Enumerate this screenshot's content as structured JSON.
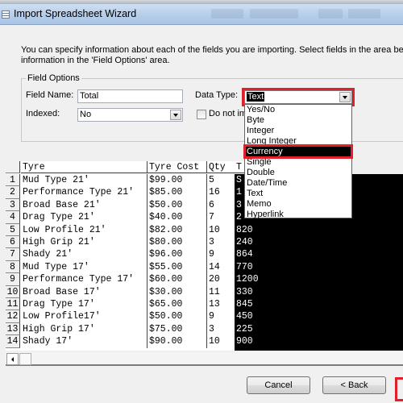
{
  "window": {
    "title": "Import Spreadsheet Wizard"
  },
  "intro": {
    "line1": "You can specify information about each of the fields you are importing. Select fields in the area below. You",
    "line2": "information in the 'Field Options' area."
  },
  "field_options": {
    "legend": "Field Options",
    "field_name_label": "Field Name:",
    "field_name_value": "Total",
    "indexed_label": "Indexed:",
    "indexed_value": "No",
    "data_type_label": "Data Type:",
    "data_type_value": "Text",
    "do_not_import_label": "Do not imp",
    "do_not_import_checked": false,
    "data_type_options": [
      "Yes/No",
      "Byte",
      "Integer",
      "Long Integer",
      "Currency",
      "Single",
      "Double",
      "Date/Time",
      "Text",
      "Memo",
      "Hyperlink"
    ],
    "highlighted_option": "Currency",
    "highlight_color": "#e0202a"
  },
  "grid": {
    "columns": [
      "Tyre",
      "Tyre Cost",
      "Qty",
      "T"
    ],
    "rows": [
      {
        "n": "1",
        "tyre": "Mud Type 21'",
        "cost": "$99.00",
        "qty": "5",
        "total": "S"
      },
      {
        "n": "2",
        "tyre": "Performance Type 21'",
        "cost": "$85.00",
        "qty": "16",
        "total": "1"
      },
      {
        "n": "3",
        "tyre": "Broad Base 21'",
        "cost": "$50.00",
        "qty": "6",
        "total": "3"
      },
      {
        "n": "4",
        "tyre": "Drag Type 21'",
        "cost": "$40.00",
        "qty": "7",
        "total": "2"
      },
      {
        "n": "5",
        "tyre": "Low Profile 21'",
        "cost": "$82.00",
        "qty": "10",
        "total": "820"
      },
      {
        "n": "6",
        "tyre": "High Grip 21'",
        "cost": "$80.00",
        "qty": "3",
        "total": "240"
      },
      {
        "n": "7",
        "tyre": "Shady 21'",
        "cost": "$96.00",
        "qty": "9",
        "total": "864"
      },
      {
        "n": "8",
        "tyre": "Mud Type 17'",
        "cost": "$55.00",
        "qty": "14",
        "total": "770"
      },
      {
        "n": "9",
        "tyre": "Performance Type 17'",
        "cost": "$60.00",
        "qty": "20",
        "total": "1200"
      },
      {
        "n": "10",
        "tyre": "Broad Base 17'",
        "cost": "$30.00",
        "qty": "11",
        "total": "330"
      },
      {
        "n": "11",
        "tyre": "Drag Type 17'",
        "cost": "$65.00",
        "qty": "13",
        "total": "845"
      },
      {
        "n": "12",
        "tyre": "Low Profile17'",
        "cost": "$50.00",
        "qty": "9",
        "total": "450"
      },
      {
        "n": "13",
        "tyre": "High Grip 17'",
        "cost": "$75.00",
        "qty": "3",
        "total": "225"
      },
      {
        "n": "14",
        "tyre": "Shady 17'",
        "cost": "$90.00",
        "qty": "10",
        "total": "900"
      }
    ]
  },
  "buttons": {
    "cancel": "Cancel",
    "back": "< Back"
  }
}
